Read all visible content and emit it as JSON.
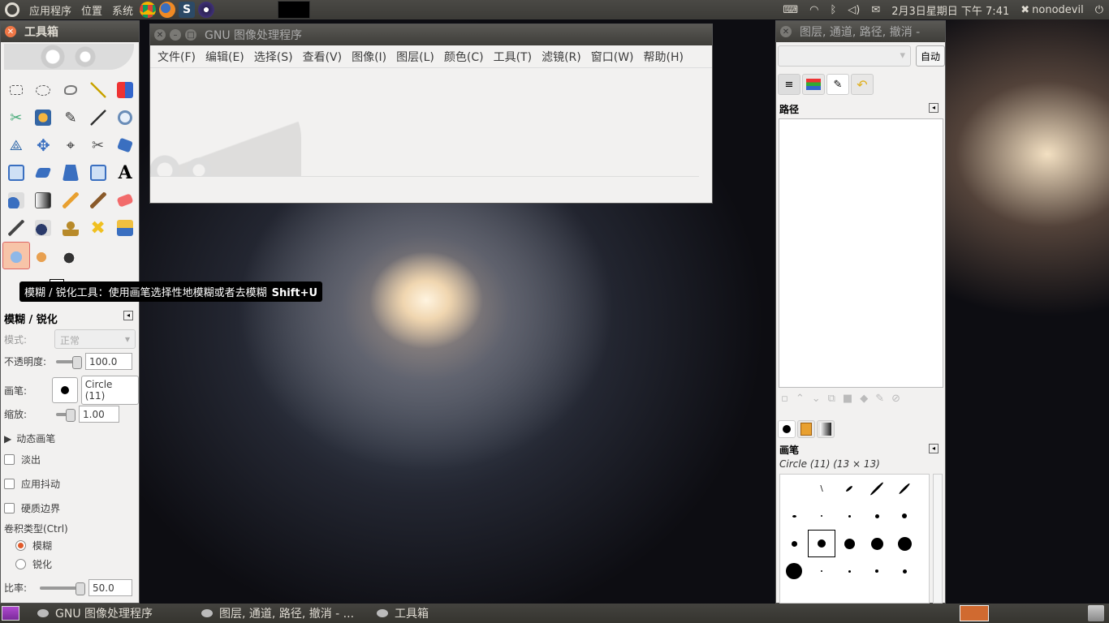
{
  "top_panel": {
    "menus": [
      "应用程序",
      "位置",
      "系统"
    ],
    "datetime": "2月3日星期日 下午 7:41",
    "user": "nonodevil",
    "launchers": [
      "chrome-icon",
      "firefox-icon",
      "s-icon",
      "eclipse-icon"
    ]
  },
  "bottom_panel": {
    "tasks": [
      "GNU 图像处理程序",
      "图层, 通道, 路径, 撤消 - ...",
      "工具箱"
    ]
  },
  "toolbox": {
    "title": "工具箱",
    "tooltip_text": "模糊 / 锐化工具：使用画笔选择性地模糊或者去模糊",
    "tooltip_shortcut": "Shift+U",
    "options_title": "模糊 / 锐化",
    "mode_label": "模式:",
    "mode_value": "正常",
    "opacity_label": "不透明度:",
    "opacity_value": "100.0",
    "brush_label": "画笔:",
    "brush_value": "Circle (11)",
    "scale_label": "缩放:",
    "scale_value": "1.00",
    "dynamics_label": "动态画笔",
    "fade_label": "淡出",
    "jitter_label": "应用抖动",
    "hard_edge_label": "硬质边界",
    "convolve_label": "卷积类型(Ctrl)",
    "blur_label": "模糊",
    "sharpen_label": "锐化",
    "rate_label": "比率:",
    "rate_value": "50.0"
  },
  "main_window": {
    "title": "GNU 图像处理程序",
    "menus": [
      "文件(F)",
      "编辑(E)",
      "选择(S)",
      "查看(V)",
      "图像(I)",
      "图层(L)",
      "颜色(C)",
      "工具(T)",
      "滤镜(R)",
      "窗口(W)",
      "帮助(H)"
    ]
  },
  "dock": {
    "title": "图层, 通道, 路径, 撤消 -",
    "auto_button": "自动",
    "paths_label": "路径",
    "brushes_label": "画笔",
    "brush_info": "Circle (11) (13 × 13)"
  }
}
